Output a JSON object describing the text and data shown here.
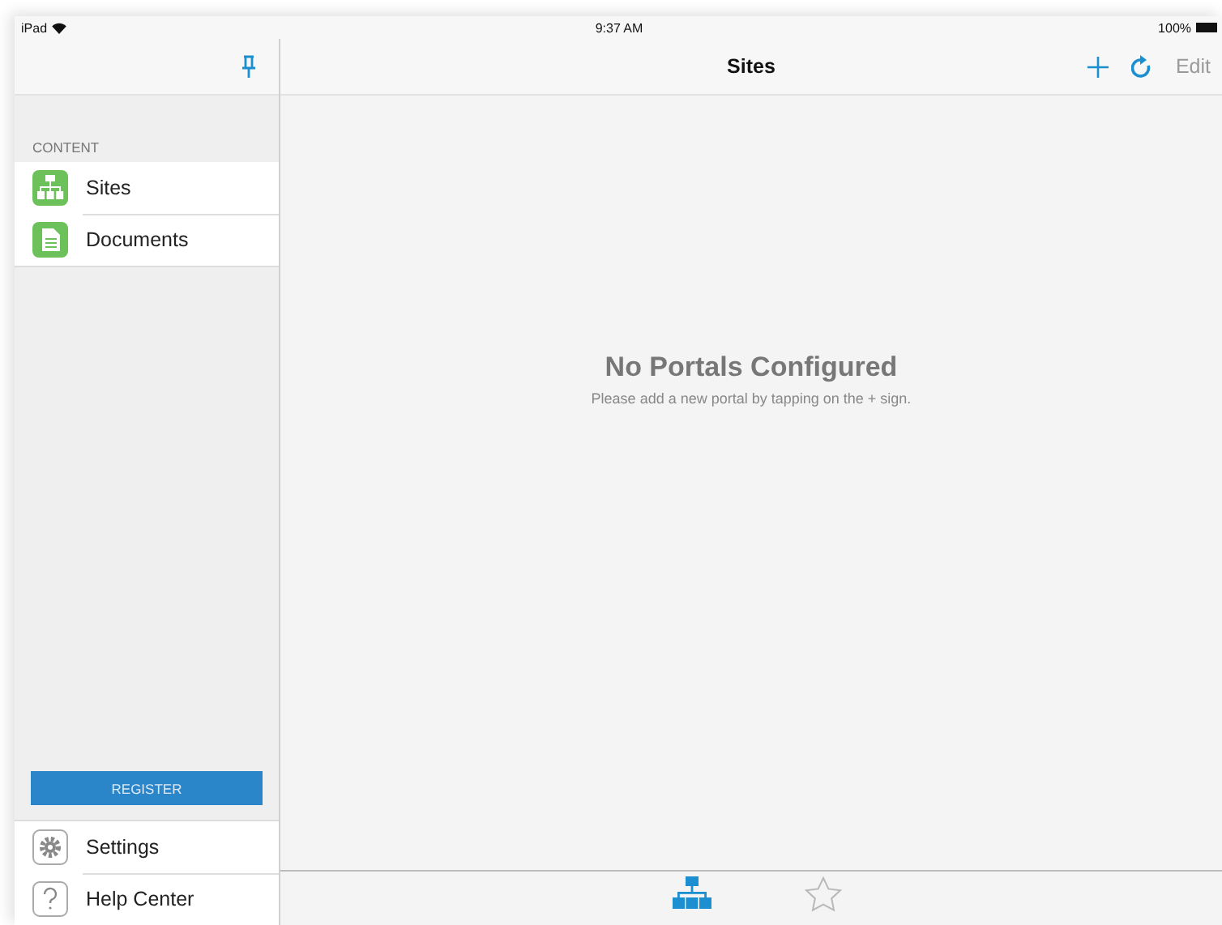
{
  "status_bar": {
    "device": "iPad",
    "time": "9:37 AM",
    "battery": "100%"
  },
  "sidebar": {
    "section": "CONTENT",
    "items": [
      {
        "label": "Sites",
        "kind": "sites",
        "selected": false
      },
      {
        "label": "Documents",
        "kind": "documents",
        "selected": false
      }
    ],
    "register_button": "REGISTER",
    "footer_items": [
      {
        "label": "Settings",
        "kind": "settings"
      },
      {
        "label": "Help Center",
        "kind": "help"
      }
    ]
  },
  "nav_bar": {
    "title": "Sites",
    "edit": {
      "label": "Edit",
      "disabled": true
    }
  },
  "empty_state": {
    "title": "No Portals Configured",
    "message": "Please add a new portal by tapping on the + sign."
  },
  "tab_bar": {
    "tabs": [
      {
        "kind": "sites",
        "selected": true
      },
      {
        "kind": "favorites",
        "selected": false
      }
    ]
  }
}
